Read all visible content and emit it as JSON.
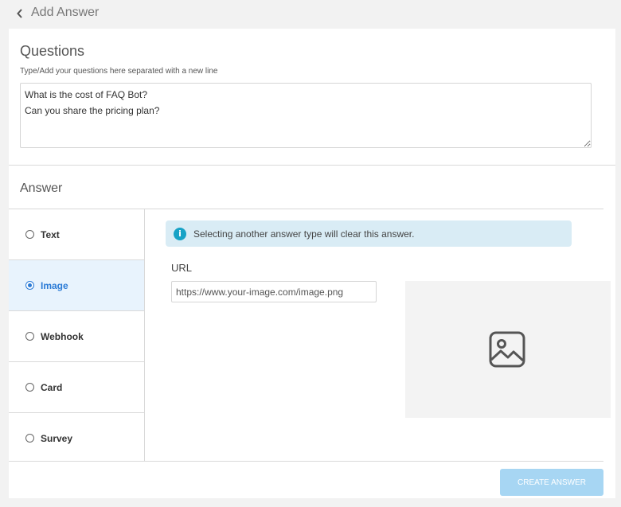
{
  "header": {
    "title": "Add Answer",
    "back_icon": "chevron-left-icon"
  },
  "questions": {
    "title": "Questions",
    "hint": "Type/Add your questions here separated with a new line",
    "value": "What is the cost of FAQ Bot?\nCan you share the pricing plan?"
  },
  "answer": {
    "title": "Answer",
    "selected_type": "Image",
    "types": [
      {
        "label": "Text",
        "selected": false
      },
      {
        "label": "Image",
        "selected": true
      },
      {
        "label": "Webhook",
        "selected": false
      },
      {
        "label": "Card",
        "selected": false
      },
      {
        "label": "Survey",
        "selected": false
      }
    ],
    "info_message": "Selecting another answer type will clear this answer.",
    "info_icon": "info-icon",
    "url_label": "URL",
    "url_placeholder": "https://www.your-image.com/image.png",
    "preview_icon": "image-placeholder-icon"
  },
  "footer": {
    "create_label": "CREATE ANSWER"
  },
  "colors": {
    "accent": "#2b7bd6",
    "selected_bg": "#e8f3fd",
    "info_bg": "#d9ecf5",
    "info_icon": "#17a2c6",
    "button_disabled": "#a7d6f3",
    "page_bg": "#f2f2f2"
  }
}
